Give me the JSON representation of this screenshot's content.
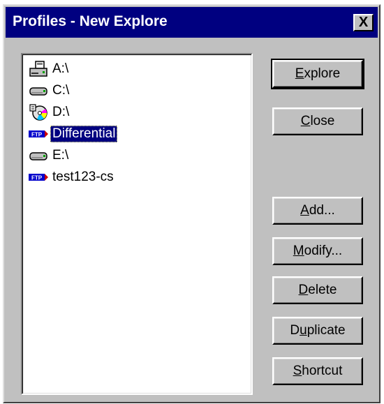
{
  "window": {
    "title": "Profiles - New Explore",
    "close_glyph": "X"
  },
  "profiles": [
    {
      "label": "A:\\",
      "icon": "floppy-drive-icon",
      "selected": false
    },
    {
      "label": "C:\\",
      "icon": "hard-drive-icon",
      "selected": false
    },
    {
      "label": "D:\\",
      "icon": "cd-drive-icon",
      "selected": false
    },
    {
      "label": "Differential",
      "icon": "ftp-icon",
      "selected": true
    },
    {
      "label": "E:\\",
      "icon": "hard-drive-icon",
      "selected": false
    },
    {
      "label": "test123-cs",
      "icon": "ftp-icon",
      "selected": false
    }
  ],
  "buttons": {
    "explore": {
      "pre": "",
      "key": "E",
      "post": "xplore"
    },
    "close": {
      "pre": "",
      "key": "C",
      "post": "lose"
    },
    "add": {
      "pre": "",
      "key": "A",
      "post": "dd..."
    },
    "modify": {
      "pre": "",
      "key": "M",
      "post": "odify..."
    },
    "delete": {
      "pre": "",
      "key": "D",
      "post": "elete"
    },
    "duplicate": {
      "pre": "D",
      "key": "u",
      "post": "plicate"
    },
    "shortcut": {
      "pre": "",
      "key": "S",
      "post": "hortcut"
    }
  },
  "colors": {
    "titlebar": "#000080",
    "face": "#c0c0c0",
    "selection": "#000080",
    "ftp_badge": "#0000cc"
  }
}
